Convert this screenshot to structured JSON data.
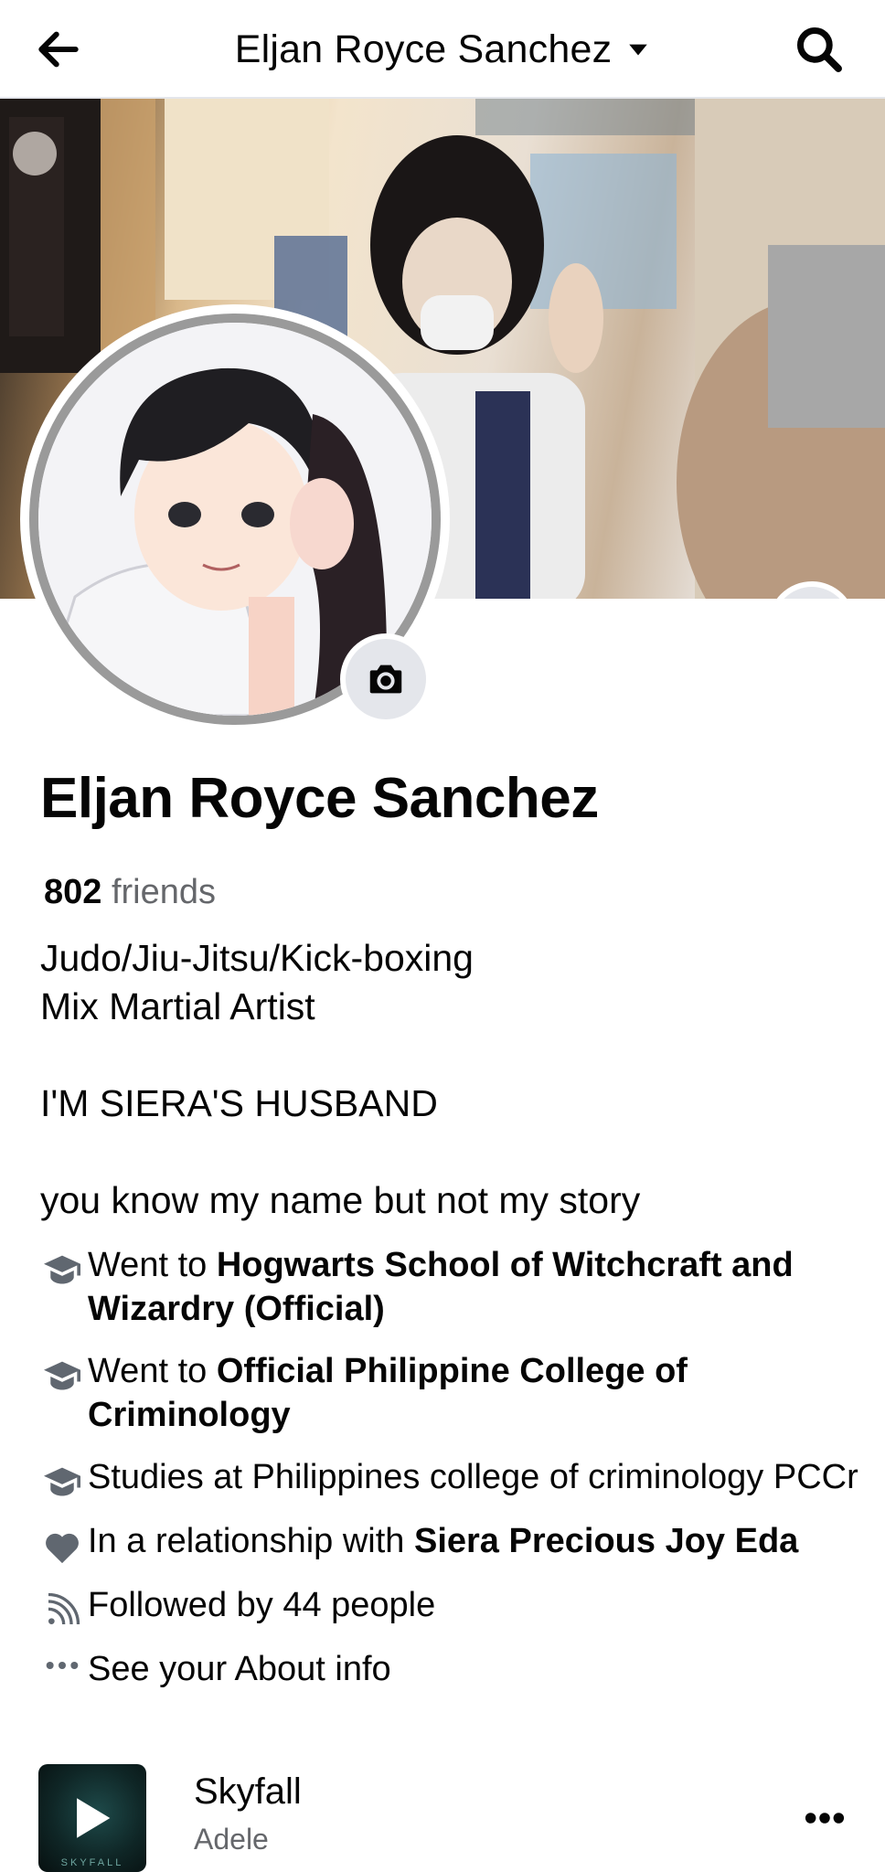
{
  "header": {
    "title": "Eljan Royce Sanchez",
    "back_icon": "arrow-left-icon",
    "dropdown_icon": "caret-down-icon",
    "search_icon": "search-icon"
  },
  "profile": {
    "name": "Eljan Royce Sanchez",
    "friends_count": "802",
    "friends_label": "friends",
    "bio": "Judo/Jiu-Jitsu/Kick-boxing\nMix Martial Artist\n\nI'M SIERA'S HUSBAND\n\nyou know my name but not my story"
  },
  "details": [
    {
      "icon": "graduation-cap-icon",
      "prefix": "Went to ",
      "bold": "Hogwarts School of Witchcraft and Wizardry (Official)"
    },
    {
      "icon": "graduation-cap-icon",
      "prefix": "Went to ",
      "bold": "Official Philippine College of Criminology"
    },
    {
      "icon": "graduation-cap-icon",
      "prefix": "Studies at Philippines college of criminology PCCr",
      "bold": ""
    },
    {
      "icon": "heart-icon",
      "prefix": "In a relationship with ",
      "bold": "Siera Precious Joy Eda"
    },
    {
      "icon": "rss-icon",
      "prefix": "Followed by 44 people",
      "bold": ""
    },
    {
      "icon": "more-dots-icon",
      "prefix": "See your About info",
      "bold": ""
    }
  ],
  "music": {
    "song": "Skyfall",
    "artist": "Adele",
    "album_text": "SKYFALL"
  },
  "colors": {
    "text_primary": "#050505",
    "text_secondary": "#65676b",
    "icon_bg": "#e4e6eb",
    "icon_dark": "#606770"
  }
}
